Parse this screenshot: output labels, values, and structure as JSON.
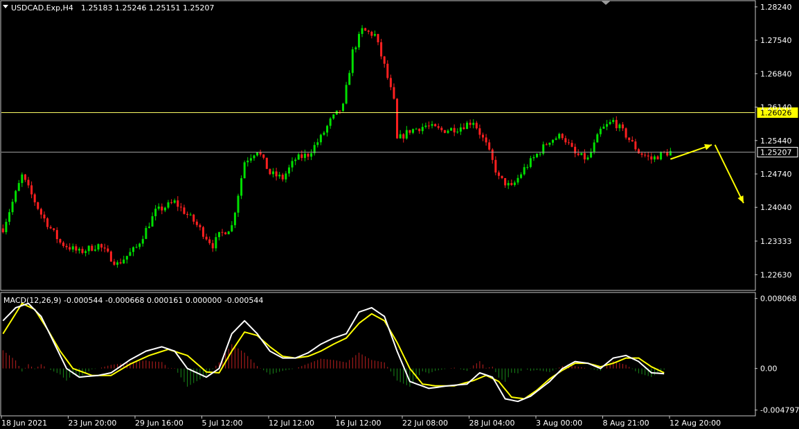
{
  "header": {
    "symbol_label": "USDCAD.Exp,H4",
    "ohlc_label": "1.25183 1.25246 1.25151 1.25207"
  },
  "macd_header": {
    "label": "MACD(12,26,9) -0.000544 -0.000668 0.000161 0.000000 -0.000544"
  },
  "colors": {
    "background": "#000000",
    "bull": "#00e000",
    "bear": "#ff2020",
    "resistance_line": "#ffff66",
    "price_line": "#a0a0a0",
    "macd_main": "#ffffff",
    "macd_signal": "#ffff00",
    "hist_positive": "#c02020",
    "hist_negative": "#1a8a1a",
    "arrow": "#ffff00",
    "frame": "#c8c8c8"
  },
  "chart_data": [
    {
      "type": "candlestick",
      "title": "USDCAD.Exp,H4",
      "ylim": [
        1.2233,
        1.2834
      ],
      "y_ticks": [
        1.2824,
        1.2754,
        1.2684,
        1.2614,
        1.2544,
        1.2474,
        1.2404,
        1.23333,
        1.2263
      ],
      "y_tick_labels": [
        "1.28240",
        "1.27540",
        "1.26840",
        "1.26140",
        "1.25440",
        "1.24740",
        "1.24040",
        "1.23333",
        "1.22630"
      ],
      "x_tick_labels": [
        "18 Jun 2021",
        "23 Jun 20:00",
        "29 Jun 16:00",
        "5 Jul 12:00",
        "12 Jul 12:00",
        "16 Jul 12:00",
        "22 Jul 08:00",
        "28 Jul 04:00",
        "3 Aug 00:00",
        "8 Aug 21:00",
        "12 Aug 20:00"
      ],
      "horizontal_lines": [
        {
          "label": "1.26026",
          "value": 1.26026
        },
        {
          "label": "1.25207",
          "value": 1.25207
        }
      ],
      "close_path": [
        [
          0,
          1.236
        ],
        [
          6,
          1.247
        ],
        [
          12,
          1.239
        ],
        [
          18,
          1.233
        ],
        [
          24,
          1.231
        ],
        [
          30,
          1.2325
        ],
        [
          36,
          1.2285
        ],
        [
          42,
          1.232
        ],
        [
          48,
          1.2395
        ],
        [
          54,
          1.2415
        ],
        [
          60,
          1.2375
        ],
        [
          66,
          1.2325
        ],
        [
          68,
          1.2345
        ],
        [
          72,
          1.2365
        ],
        [
          76,
          1.25
        ],
        [
          80,
          1.2525
        ],
        [
          84,
          1.2475
        ],
        [
          88,
          1.2465
        ],
        [
          92,
          1.2505
        ],
        [
          96,
          1.2515
        ],
        [
          100,
          1.255
        ],
        [
          103,
          1.2585
        ],
        [
          107,
          1.2615
        ],
        [
          110,
          1.273
        ],
        [
          113,
          1.2775
        ],
        [
          117,
          1.2765
        ],
        [
          120,
          1.27
        ],
        [
          123,
          1.2625
        ],
        [
          124,
          1.2545
        ],
        [
          128,
          1.2565
        ],
        [
          133,
          1.2575
        ],
        [
          138,
          1.2565
        ],
        [
          143,
          1.257
        ],
        [
          148,
          1.2585
        ],
        [
          152,
          1.2535
        ],
        [
          156,
          1.2465
        ],
        [
          160,
          1.2445
        ],
        [
          164,
          1.2485
        ],
        [
          168,
          1.2515
        ],
        [
          172,
          1.2545
        ],
        [
          176,
          1.2555
        ],
        [
          180,
          1.2515
        ],
        [
          184,
          1.2505
        ],
        [
          188,
          1.2565
        ],
        [
          192,
          1.2585
        ],
        [
          196,
          1.2555
        ],
        [
          200,
          1.252
        ],
        [
          204,
          1.2505
        ],
        [
          207,
          1.2515
        ],
        [
          210,
          1.252
        ]
      ],
      "annotation_arrows": [
        {
          "from": [
            210,
            1.2505
          ],
          "to": [
            223,
            1.2535
          ]
        },
        {
          "from": [
            224,
            1.2535
          ],
          "to": [
            233,
            1.2413
          ]
        }
      ]
    },
    {
      "type": "macd",
      "title": "MACD(12,26,9) -0.000544 -0.000668 0.000161 0.000000 -0.000544",
      "ylim": [
        -0.0053,
        0.0086
      ],
      "y_ticks": [
        0.008068,
        0.0,
        -0.004797
      ],
      "y_tick_labels": [
        "0.008068",
        "0.00",
        "-0.004797"
      ],
      "main_path": [
        [
          0,
          0.0055
        ],
        [
          4,
          0.007
        ],
        [
          8,
          0.0075
        ],
        [
          12,
          0.006
        ],
        [
          16,
          0.003
        ],
        [
          20,
          0.0
        ],
        [
          24,
          -0.001
        ],
        [
          30,
          -0.0008
        ],
        [
          34,
          -0.0005
        ],
        [
          40,
          0.001
        ],
        [
          45,
          0.002
        ],
        [
          50,
          0.0025
        ],
        [
          54,
          0.002
        ],
        [
          58,
          0.0
        ],
        [
          64,
          -0.001
        ],
        [
          68,
          0.0
        ],
        [
          72,
          0.004
        ],
        [
          76,
          0.0055
        ],
        [
          80,
          0.004
        ],
        [
          84,
          0.002
        ],
        [
          88,
          0.0012
        ],
        [
          92,
          0.0012
        ],
        [
          96,
          0.0018
        ],
        [
          100,
          0.0028
        ],
        [
          104,
          0.0035
        ],
        [
          108,
          0.004
        ],
        [
          112,
          0.0065
        ],
        [
          116,
          0.007
        ],
        [
          120,
          0.006
        ],
        [
          124,
          0.002
        ],
        [
          128,
          -0.0015
        ],
        [
          134,
          -0.0023
        ],
        [
          140,
          -0.002
        ],
        [
          146,
          -0.0018
        ],
        [
          150,
          -0.0005
        ],
        [
          154,
          -0.001
        ],
        [
          158,
          -0.0035
        ],
        [
          162,
          -0.0038
        ],
        [
          166,
          -0.0032
        ],
        [
          172,
          -0.0015
        ],
        [
          176,
          0.0
        ],
        [
          180,
          0.0008
        ],
        [
          184,
          0.0006
        ],
        [
          188,
          0.0
        ],
        [
          192,
          0.0012
        ],
        [
          196,
          0.0015
        ],
        [
          200,
          0.0008
        ],
        [
          204,
          -0.0005
        ],
        [
          208,
          -0.0006
        ]
      ],
      "signal_path": [
        [
          0,
          0.004
        ],
        [
          6,
          0.0075
        ],
        [
          10,
          0.0068
        ],
        [
          14,
          0.0045
        ],
        [
          18,
          0.002
        ],
        [
          22,
          0.0
        ],
        [
          28,
          -0.0008
        ],
        [
          34,
          -0.0008
        ],
        [
          40,
          0.0005
        ],
        [
          46,
          0.0015
        ],
        [
          52,
          0.0022
        ],
        [
          58,
          0.0015
        ],
        [
          64,
          -0.0004
        ],
        [
          68,
          -0.0005
        ],
        [
          72,
          0.002
        ],
        [
          76,
          0.0042
        ],
        [
          80,
          0.0038
        ],
        [
          84,
          0.0025
        ],
        [
          88,
          0.0014
        ],
        [
          92,
          0.0012
        ],
        [
          96,
          0.0014
        ],
        [
          100,
          0.002
        ],
        [
          104,
          0.0028
        ],
        [
          108,
          0.0035
        ],
        [
          112,
          0.0052
        ],
        [
          116,
          0.0063
        ],
        [
          120,
          0.0055
        ],
        [
          124,
          0.003
        ],
        [
          128,
          0.0
        ],
        [
          132,
          -0.0018
        ],
        [
          136,
          -0.002
        ],
        [
          142,
          -0.002
        ],
        [
          148,
          -0.0014
        ],
        [
          152,
          -0.0008
        ],
        [
          156,
          -0.0015
        ],
        [
          160,
          -0.0033
        ],
        [
          164,
          -0.0035
        ],
        [
          168,
          -0.0025
        ],
        [
          172,
          -0.0012
        ],
        [
          176,
          -0.0002
        ],
        [
          180,
          0.0006
        ],
        [
          184,
          0.0006
        ],
        [
          188,
          0.0002
        ],
        [
          192,
          0.0006
        ],
        [
          196,
          0.0012
        ],
        [
          200,
          0.0012
        ],
        [
          204,
          0.0002
        ],
        [
          208,
          -0.0005
        ]
      ]
    }
  ]
}
